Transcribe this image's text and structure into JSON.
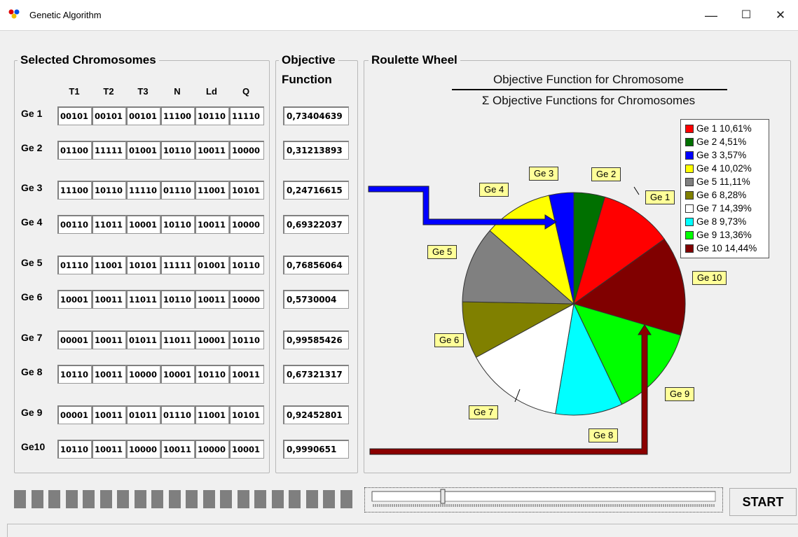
{
  "window": {
    "title": "Genetic Algorithm",
    "minimize": "—",
    "maximize": "☐",
    "close": "✕"
  },
  "selected": {
    "title": "Selected Chromosomes",
    "columns": [
      "T1",
      "T2",
      "T3",
      "N",
      "Ld",
      "Q"
    ],
    "rows": [
      {
        "label": "Ge 1",
        "genes": [
          "00101",
          "00101",
          "00101",
          "11100",
          "10110",
          "11110"
        ]
      },
      {
        "label": "Ge 2",
        "genes": [
          "01100",
          "11111",
          "01001",
          "10110",
          "10011",
          "10000"
        ]
      },
      {
        "label": "Ge 3",
        "genes": [
          "11100",
          "10110",
          "11110",
          "01110",
          "11001",
          "10101"
        ]
      },
      {
        "label": "Ge 4",
        "genes": [
          "00110",
          "11011",
          "10001",
          "10110",
          "10011",
          "10000"
        ]
      },
      {
        "label": "Ge 5",
        "genes": [
          "01110",
          "11001",
          "10101",
          "11111",
          "01001",
          "10110"
        ]
      },
      {
        "label": "Ge 6",
        "genes": [
          "10001",
          "10011",
          "11011",
          "10110",
          "10011",
          "10000"
        ]
      },
      {
        "label": "Ge 7",
        "genes": [
          "00001",
          "10011",
          "01011",
          "11011",
          "10001",
          "10110"
        ]
      },
      {
        "label": "Ge 8",
        "genes": [
          "10110",
          "10011",
          "10000",
          "10001",
          "10110",
          "10011"
        ]
      },
      {
        "label": "Ge 9",
        "genes": [
          "00001",
          "10011",
          "01011",
          "01110",
          "11001",
          "10101"
        ]
      },
      {
        "label": "Ge10",
        "genes": [
          "10110",
          "10011",
          "10000",
          "10011",
          "10000",
          "10001"
        ]
      }
    ]
  },
  "objective": {
    "title_line1": "Objective",
    "title_line2": "Function",
    "values": [
      "0,73404639",
      "0,31213893",
      "0,24716615",
      "0,69322037",
      "0,76856064",
      "0,5730004",
      "0,99585426",
      "0,67321317",
      "0,92452801",
      "0,9990651"
    ]
  },
  "roulette": {
    "title": "Roulette Wheel",
    "formula_numerator": "Objective Function for Chromosome",
    "formula_denominator": "Σ Objective Functions for Chromosomes",
    "legend": [
      "Ge 1 10,61%",
      "Ge 2 4,51%",
      "Ge 3 3,57%",
      "Ge 4 10,02%",
      "Ge 5 11,11%",
      "Ge 6 8,28%",
      "Ge 7 14,39%",
      "Ge 8 9,73%",
      "Ge 9 13,36%",
      "Ge 10 14,44%"
    ],
    "slice_labels": [
      "Ge 1",
      "Ge 2",
      "Ge 3",
      "Ge 4",
      "Ge 5",
      "Ge 6",
      "Ge 7",
      "Ge 8",
      "Ge 9",
      "Ge 10"
    ],
    "colors": [
      "#ff0000",
      "#007000",
      "#0000ff",
      "#ffff00",
      "#808080",
      "#808000",
      "#ffffff",
      "#00ffff",
      "#00ff00",
      "#800000"
    ]
  },
  "chart_data": {
    "type": "pie",
    "categories": [
      "Ge 1",
      "Ge 2",
      "Ge 3",
      "Ge 4",
      "Ge 5",
      "Ge 6",
      "Ge 7",
      "Ge 8",
      "Ge 9",
      "Ge 10"
    ],
    "values": [
      10.61,
      4.51,
      3.57,
      10.02,
      11.11,
      8.28,
      14.39,
      9.73,
      13.36,
      14.44
    ],
    "title": "Roulette Wheel",
    "legend_position": "top-right"
  },
  "controls": {
    "start_label": "START",
    "progress_segments": 20,
    "slider_value_fraction": 0.2
  }
}
